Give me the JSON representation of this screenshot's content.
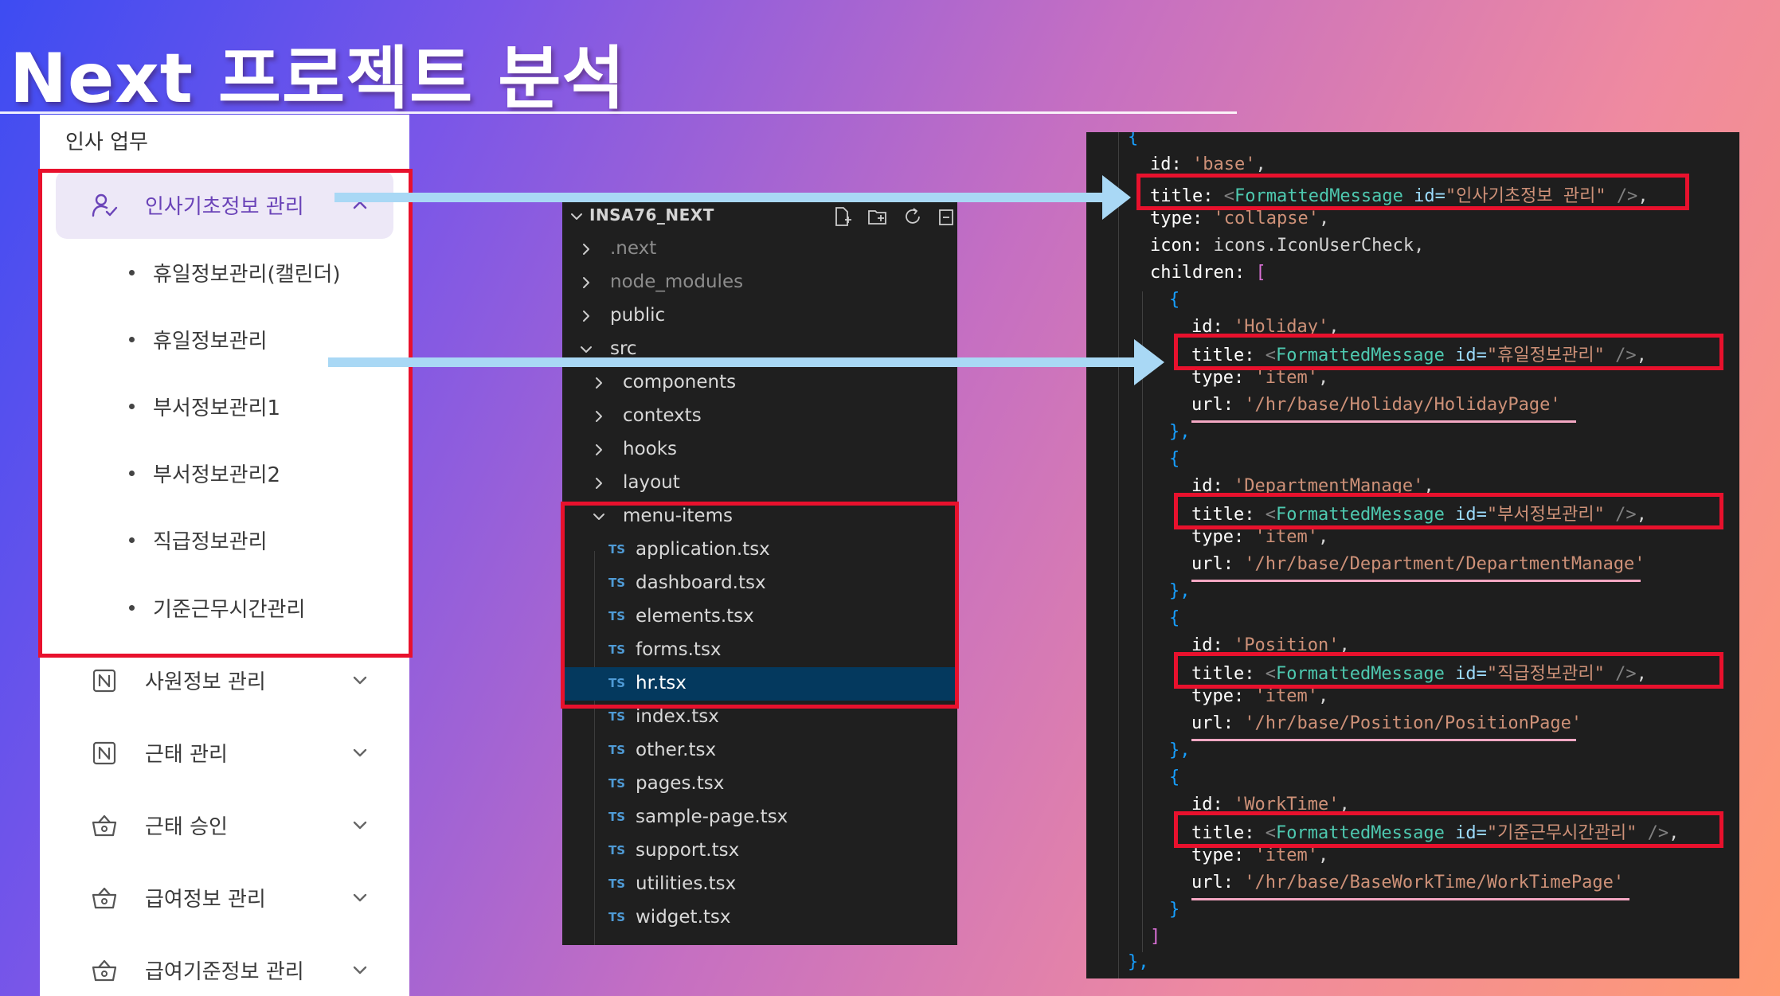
{
  "slide": {
    "title": "Next 프로젝트 분석"
  },
  "sidebar": {
    "group_label": "인사 업무",
    "selected": {
      "label": "인사기초정보 관리",
      "icon": "user-check-icon"
    },
    "sub_items": [
      {
        "label": "휴일정보관리(캘린더)"
      },
      {
        "label": "휴일정보관리"
      },
      {
        "label": "부서정보관리1"
      },
      {
        "label": "부서정보관리2"
      },
      {
        "label": "직급정보관리"
      },
      {
        "label": "기준근무시간관리"
      }
    ],
    "items": [
      {
        "label": "사원정보 관리",
        "icon": "notion-icon"
      },
      {
        "label": "근태 관리",
        "icon": "notion-icon"
      },
      {
        "label": "근태 승인",
        "icon": "basket-icon"
      },
      {
        "label": "급여정보 관리",
        "icon": "basket-icon"
      },
      {
        "label": "급여기준정보 관리",
        "icon": "basket-icon"
      }
    ]
  },
  "explorer": {
    "root": "INSA76_NEXT",
    "tree": [
      {
        "name": ".next",
        "kind": "folder",
        "state": "collapsed"
      },
      {
        "name": "node_modules",
        "kind": "folder",
        "state": "collapsed"
      },
      {
        "name": "public",
        "kind": "folder",
        "state": "collapsed"
      },
      {
        "name": "src",
        "kind": "folder",
        "state": "expanded"
      },
      {
        "name": "components",
        "kind": "folder",
        "state": "collapsed"
      },
      {
        "name": "contexts",
        "kind": "folder",
        "state": "collapsed"
      },
      {
        "name": "hooks",
        "kind": "folder",
        "state": "collapsed"
      },
      {
        "name": "layout",
        "kind": "folder",
        "state": "collapsed"
      },
      {
        "name": "menu-items",
        "kind": "folder",
        "state": "expanded"
      },
      {
        "name": "application.tsx",
        "kind": "file"
      },
      {
        "name": "dashboard.tsx",
        "kind": "file"
      },
      {
        "name": "elements.tsx",
        "kind": "file"
      },
      {
        "name": "forms.tsx",
        "kind": "file"
      },
      {
        "name": "hr.tsx",
        "kind": "file",
        "active": true
      },
      {
        "name": "index.tsx",
        "kind": "file"
      },
      {
        "name": "other.tsx",
        "kind": "file"
      },
      {
        "name": "pages.tsx",
        "kind": "file"
      },
      {
        "name": "sample-page.tsx",
        "kind": "file"
      },
      {
        "name": "support.tsx",
        "kind": "file"
      },
      {
        "name": "utilities.tsx",
        "kind": "file"
      },
      {
        "name": "widget.tsx",
        "kind": "file"
      }
    ],
    "file_badge": "TS"
  },
  "code": {
    "k_id": "id:",
    "k_title": "title:",
    "k_type": "type:",
    "k_icon": "icon:",
    "k_url": "url:",
    "k_children": "children:",
    "tag_open": "<",
    "tag_name": "FormattedMessage",
    "attr_id": "id=",
    "tag_close": "/>",
    "comma": ",",
    "brace_open": "{",
    "brace_close": "}",
    "brace_close_comma": "},",
    "bracket_open": "[",
    "bracket_close": "]",
    "root": {
      "id": "'base'",
      "title": "\"인사기초정보 관리\"",
      "type": "'collapse'",
      "icon": "icons.IconUserCheck"
    },
    "children": [
      {
        "id": "'Holiday'",
        "title": "\"휴일정보관리\"",
        "type": "'item'",
        "url": "'/hr/base/Holiday/HolidayPage'"
      },
      {
        "id": "'DepartmentManage'",
        "title": "\"부서정보관리\"",
        "type": "'item'",
        "url": "'/hr/base/Department/DepartmentManage'"
      },
      {
        "id": "'Position'",
        "title": "\"직급정보관리\"",
        "type": "'item'",
        "url": "'/hr/base/Position/PositionPage'"
      },
      {
        "id": "'WorkTime'",
        "title": "\"기준근무시간관리\"",
        "type": "'item'",
        "url": "'/hr/base/BaseWorkTime/WorkTimePage'"
      }
    ]
  },
  "colors": {
    "highlight_box": "#e8112d",
    "arrow": "#a9d8f5",
    "underline": "#f4a8c3",
    "sidebar_selected_bg": "#ede8f7",
    "explorer_active": "#04395e"
  }
}
